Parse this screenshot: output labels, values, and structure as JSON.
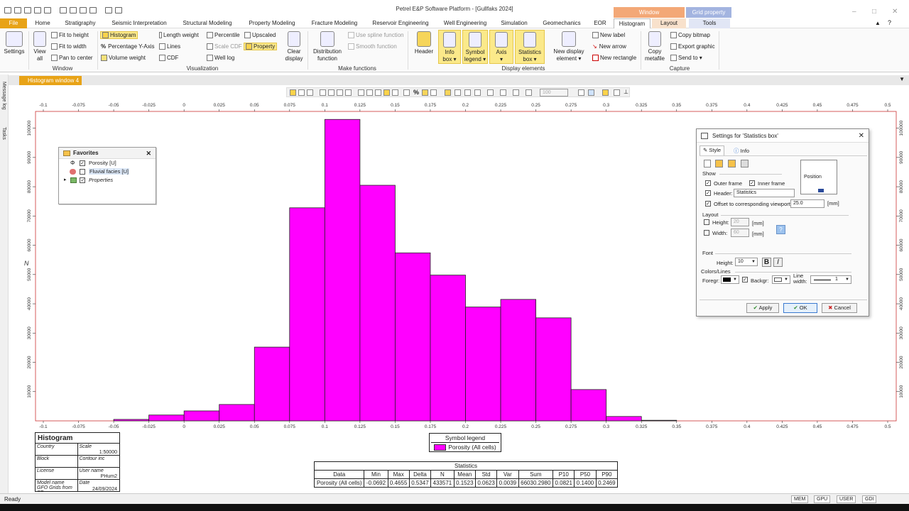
{
  "window": {
    "title": "Petrel E&P Software Platform - [Gullfaks 2024]",
    "ctx_window": "Window",
    "ctx_grid": "Grid property"
  },
  "menu": [
    "File",
    "Home",
    "Stratigraphy",
    "Seismic Interpretation",
    "Structural Modeling",
    "Property Modeling",
    "Fracture Modeling",
    "Reservoir Engineering",
    "Well Engineering",
    "Simulation",
    "Geomechanics",
    "EOR",
    "Histogram",
    "Layout",
    "Tools"
  ],
  "ribbon": {
    "settings": "Settings",
    "view_all_1": "View",
    "view_all_2": "all",
    "fit_height": "Fit to height",
    "fit_width": "Fit to width",
    "pan_center": "Pan to center",
    "histogram": "Histogram",
    "pct_y": "Percentage Y-Axis",
    "volume_weight": "Volume weight",
    "length_weight": "Length weight",
    "lines": "Lines",
    "cdf": "CDF",
    "percentile": "Percentile",
    "scale_cdf": "Scale CDF",
    "well_log": "Well log",
    "upscaled": "Upscaled",
    "property": "Property",
    "clear_1": "Clear",
    "clear_2": "display",
    "dist_1": "Distribution",
    "dist_2": "function",
    "spline": "Use spline function",
    "smooth": "Smooth function",
    "header": "Header",
    "info_1": "Info",
    "info_2": "box ▾",
    "symbol_1": "Symbol",
    "symbol_2": "legend ▾",
    "axis_1": "Axis",
    "axis_2": "▾",
    "stats_1": "Statistics",
    "stats_2": "box ▾",
    "newdisp_1": "New display",
    "newdisp_2": "element ▾",
    "new_label": "New label",
    "new_arrow": "New arrow",
    "new_rect": "New rectangle",
    "copy_meta_1": "Copy",
    "copy_meta_2": "metafile",
    "copy_bitmap": "Copy bitmap",
    "export_graphic": "Export graphic",
    "send_to": "Send to ▾",
    "groups": {
      "window": "Window",
      "visualization": "Visualization",
      "make_functions": "Make functions",
      "display_elements": "Display elements",
      "capture": "Capture"
    }
  },
  "doc_tab": "Histogram window 4",
  "side": {
    "message_log": "Message log",
    "tasks": "Tasks"
  },
  "plot_toolbar": {
    "zoom": "100"
  },
  "chart_data": {
    "type": "bar",
    "title": "",
    "xlabel": "",
    "ylabel": "N",
    "xlim": [
      -0.1,
      0.5
    ],
    "ylim": [
      0,
      105000
    ],
    "x_ticks": [
      "-0.1",
      "-0.075",
      "-0.05",
      "-0.025",
      "0",
      "0.025",
      "0.05",
      "0.075",
      "0.1",
      "0.125",
      "0.15",
      "0.175",
      "0.2",
      "0.225",
      "0.25",
      "0.275",
      "0.3",
      "0.325",
      "0.35",
      "0.375",
      "0.4",
      "0.425",
      "0.45",
      "0.475",
      "0.5"
    ],
    "y_ticks": [
      {
        "v": 10000,
        "label": "10000"
      },
      {
        "v": 20000,
        "label": "20000"
      },
      {
        "v": 30000,
        "label": "30000"
      },
      {
        "v": 40000,
        "label": "40000"
      },
      {
        "v": 50000,
        "label": "50000"
      },
      {
        "v": 60000,
        "label": "60000"
      },
      {
        "v": 70000,
        "label": "70000"
      },
      {
        "v": 80000,
        "label": "80000"
      },
      {
        "v": 90000,
        "label": "90000"
      },
      {
        "v": 100000,
        "label": "100000"
      }
    ],
    "bins": [
      {
        "x0": -0.05,
        "x1": -0.025,
        "n": 500
      },
      {
        "x0": -0.025,
        "x1": 0,
        "n": 2000
      },
      {
        "x0": 0,
        "x1": 0.025,
        "n": 3400
      },
      {
        "x0": 0.025,
        "x1": 0.05,
        "n": 5600
      },
      {
        "x0": 0.05,
        "x1": 0.075,
        "n": 25200
      },
      {
        "x0": 0.075,
        "x1": 0.1,
        "n": 72800
      },
      {
        "x0": 0.1,
        "x1": 0.125,
        "n": 103000
      },
      {
        "x0": 0.125,
        "x1": 0.15,
        "n": 80500
      },
      {
        "x0": 0.15,
        "x1": 0.175,
        "n": 57400
      },
      {
        "x0": 0.175,
        "x1": 0.2,
        "n": 49800
      },
      {
        "x0": 0.2,
        "x1": 0.225,
        "n": 38900
      },
      {
        "x0": 0.225,
        "x1": 0.25,
        "n": 41500
      },
      {
        "x0": 0.25,
        "x1": 0.275,
        "n": 35200
      },
      {
        "x0": 0.275,
        "x1": 0.3,
        "n": 10700
      },
      {
        "x0": 0.3,
        "x1": 0.325,
        "n": 1500
      },
      {
        "x0": 0.325,
        "x1": 0.35,
        "n": 200
      }
    ],
    "bar_color": "#ff00ff",
    "grid": false,
    "legend_position": "bottom-center"
  },
  "favorites": {
    "title": "Favorites",
    "items": [
      {
        "label": "Porosity [U]"
      },
      {
        "label": "Fluvial facies [U]"
      },
      {
        "label": "Properties"
      }
    ]
  },
  "title_block": {
    "title": "Histogram",
    "country": "Country",
    "scale": "Scale",
    "scale_val": "1:50000",
    "block": "Block",
    "block_val": "Contour inc",
    "license": "License",
    "user": "User name",
    "user_val": "PHum2",
    "model": "Model name",
    "date": "Date",
    "date_val": "24/09/2024",
    "model_val": "GFO Grids from SF"
  },
  "legend": {
    "title": "Symbol legend",
    "entry": "Porosity (All cells)"
  },
  "stats": {
    "title": "Statistics",
    "headers": [
      "Data",
      "Min",
      "Max",
      "Delta",
      "N",
      "Mean",
      "Std",
      "Var",
      "Sum",
      "P10",
      "P50",
      "P90"
    ],
    "row": [
      "Porosity (All cells)",
      "-0.0692",
      "0.4655",
      "0.5347",
      "433571",
      "0.1523",
      "0.0623",
      "0.0039",
      "66030.2980",
      "0.0821",
      "0.1400",
      "0.2469"
    ]
  },
  "dialog": {
    "title": "Settings for 'Statistics box'",
    "tab_style": "Style",
    "tab_info": "Info",
    "show": "Show",
    "outer_frame": "Outer frame",
    "inner_frame": "Inner frame",
    "header": "Header:",
    "header_val": "Statistics",
    "position": "Position",
    "offset": "Offset to corresponding viewport:",
    "offset_val": "25.0",
    "mm": "[mm]",
    "layout": "Layout",
    "height": "Height:",
    "height_val": "20",
    "width": "Width:",
    "width_val": "60",
    "font": "Font",
    "font_height": "Height:",
    "font_height_val": "10",
    "bold": "B",
    "italic": "I",
    "colors": "Colors/Lines",
    "foreg": "Foregr:",
    "backgr": "Backgr:",
    "line_width_1": "Line",
    "line_width_2": "width:",
    "line_width_val": "1",
    "apply": "Apply",
    "ok": "OK",
    "cancel": "Cancel"
  },
  "status": {
    "ready": "Ready",
    "mem": "MEM",
    "gpu": "GPU",
    "user": "USER",
    "gdi": "GDI"
  }
}
